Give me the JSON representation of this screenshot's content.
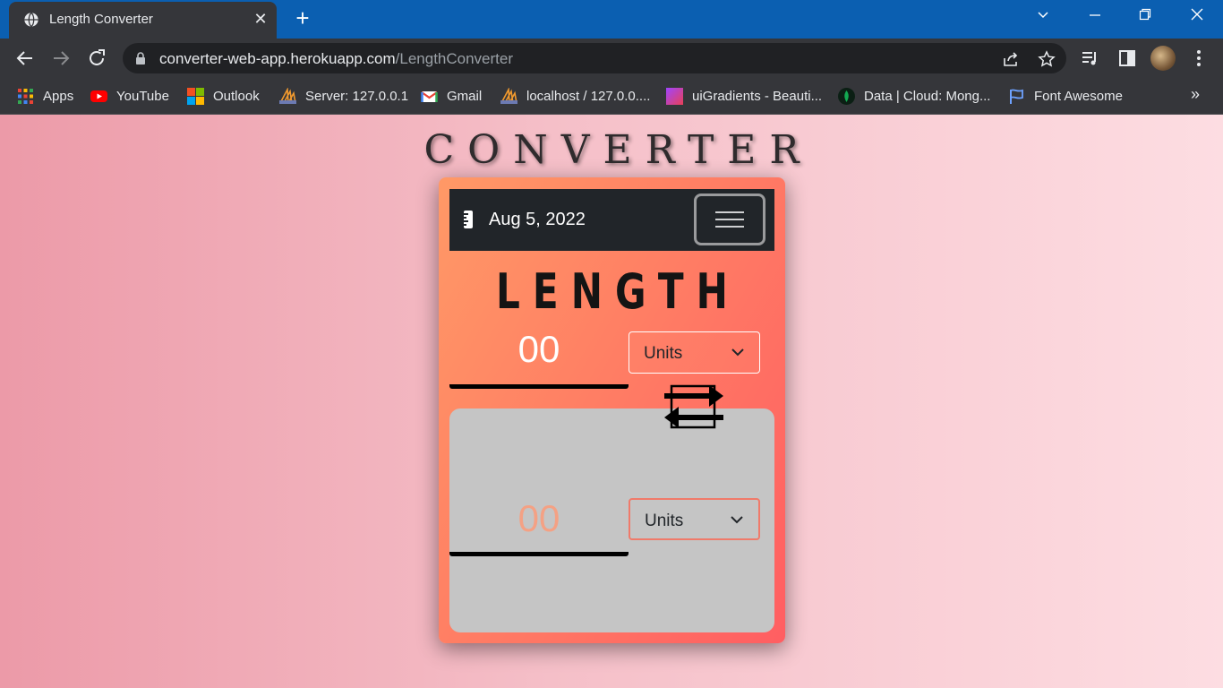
{
  "browser": {
    "tab_title": "Length Converter",
    "url_domain": "converter-web-app.herokuapp.com",
    "url_path": "/LengthConverter",
    "bookmarks": [
      {
        "label": "Apps",
        "icon": "apps-grid-icon"
      },
      {
        "label": "YouTube",
        "icon": "youtube-icon"
      },
      {
        "label": "Outlook",
        "icon": "microsoft-icon"
      },
      {
        "label": "Server: 127.0.0.1",
        "icon": "phpmyadmin-icon"
      },
      {
        "label": "Gmail",
        "icon": "gmail-icon"
      },
      {
        "label": "localhost / 127.0.0....",
        "icon": "phpmyadmin-icon"
      },
      {
        "label": "uiGradients - Beauti...",
        "icon": "uigradients-icon"
      },
      {
        "label": "Data | Cloud: Mong...",
        "icon": "mongodb-icon"
      },
      {
        "label": "Font Awesome",
        "icon": "flag-icon"
      }
    ],
    "bookmarks_more": "»"
  },
  "page": {
    "title": "CONVERTER",
    "navbar_date": "Aug 5, 2022",
    "section_title": "LENGTH",
    "input_value": "00",
    "input_unit": "Units",
    "output_value": "00",
    "output_unit": "Units"
  },
  "colors": {
    "card_gradient_start": "#ff9966",
    "card_gradient_end": "#ff5e62",
    "navbar": "#212529",
    "output_panel": "#c5c5c5",
    "output_number": "#f4a184"
  }
}
